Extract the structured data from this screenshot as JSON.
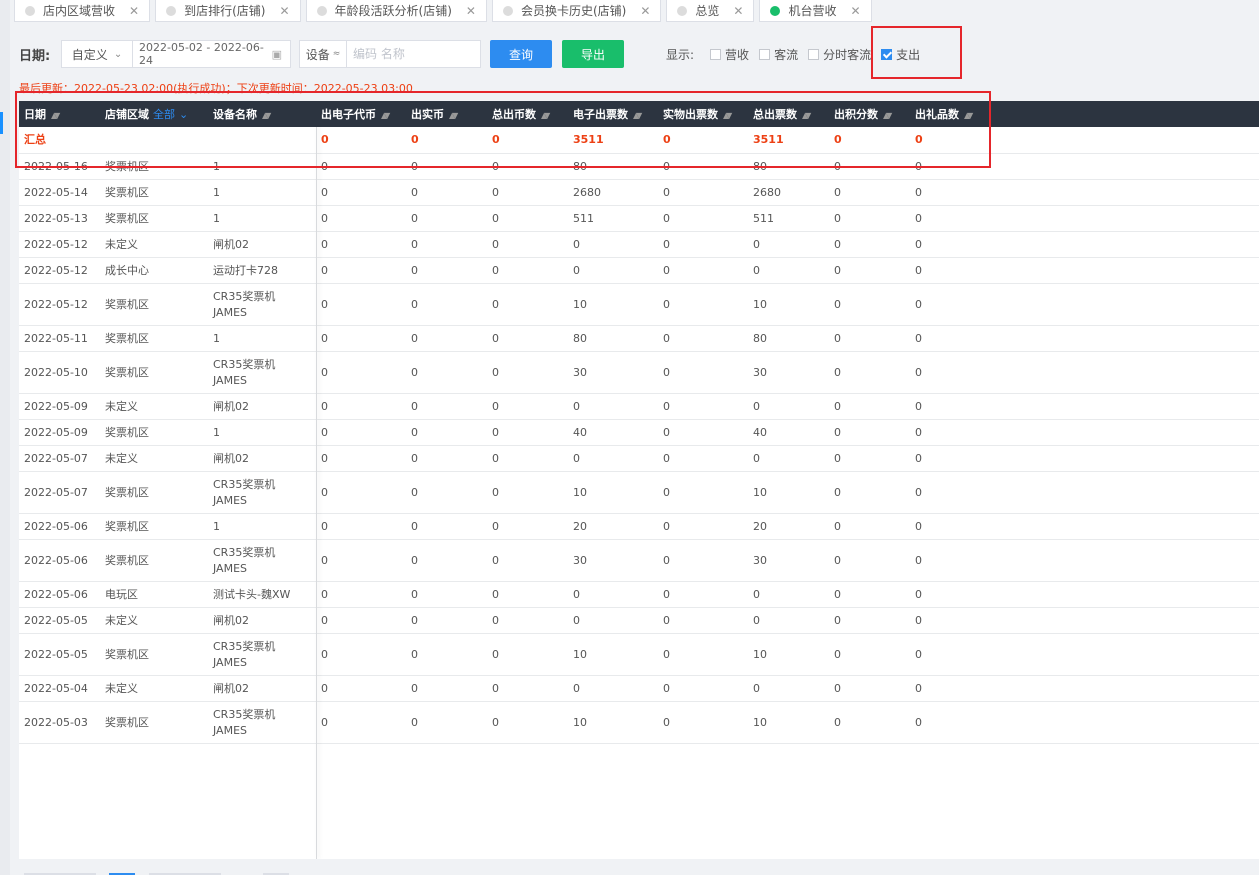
{
  "tabs": [
    {
      "label": "店内区域营收",
      "active": false
    },
    {
      "label": "到店排行(店铺)",
      "active": false
    },
    {
      "label": "年龄段活跃分析(店铺)",
      "active": false
    },
    {
      "label": "会员换卡历史(店铺)",
      "active": false
    },
    {
      "label": "总览",
      "active": false
    },
    {
      "label": "机台营收",
      "active": true
    }
  ],
  "toolbar": {
    "date_label": "日期:",
    "date_mode": "自定义",
    "date_range": "2022-05-02 - 2022-06-24",
    "device_label": "设备",
    "device_placeholder": "编码 名称",
    "query_label": "查询",
    "export_label": "导出",
    "show_label": "显示:",
    "checks": [
      {
        "label": "营收",
        "checked": false
      },
      {
        "label": "客流",
        "checked": false
      },
      {
        "label": "分时客流",
        "checked": false
      },
      {
        "label": "支出",
        "checked": true
      }
    ]
  },
  "last_update": "最后更新：2022-05-23 02:00(执行成功)；下次更新时间：2022-05-23 03:00",
  "table": {
    "columns": [
      "日期",
      "店铺区域",
      "设备名称",
      "出电子代币",
      "出实币",
      "总出币数",
      "电子出票数",
      "实物出票数",
      "总出票数",
      "出积分数",
      "出礼品数"
    ],
    "area_filter": "全部",
    "summary": [
      "汇总",
      "",
      "",
      "0",
      "0",
      "0",
      "3511",
      "0",
      "3511",
      "0",
      "0"
    ],
    "rows": [
      [
        "2022-05-16",
        "奖票机区",
        "1",
        "0",
        "0",
        "0",
        "80",
        "0",
        "80",
        "0",
        "0"
      ],
      [
        "2022-05-14",
        "奖票机区",
        "1",
        "0",
        "0",
        "0",
        "2680",
        "0",
        "2680",
        "0",
        "0"
      ],
      [
        "2022-05-13",
        "奖票机区",
        "1",
        "0",
        "0",
        "0",
        "511",
        "0",
        "511",
        "0",
        "0"
      ],
      [
        "2022-05-12",
        "未定义",
        "闸机02",
        "0",
        "0",
        "0",
        "0",
        "0",
        "0",
        "0",
        "0"
      ],
      [
        "2022-05-12",
        "成长中心",
        "运动打卡728",
        "0",
        "0",
        "0",
        "0",
        "0",
        "0",
        "0",
        "0"
      ],
      [
        "2022-05-12",
        "奖票机区",
        "CR35奖票机 JAMES",
        "0",
        "0",
        "0",
        "10",
        "0",
        "10",
        "0",
        "0"
      ],
      [
        "2022-05-11",
        "奖票机区",
        "1",
        "0",
        "0",
        "0",
        "80",
        "0",
        "80",
        "0",
        "0"
      ],
      [
        "2022-05-10",
        "奖票机区",
        "CR35奖票机 JAMES",
        "0",
        "0",
        "0",
        "30",
        "0",
        "30",
        "0",
        "0"
      ],
      [
        "2022-05-09",
        "未定义",
        "闸机02",
        "0",
        "0",
        "0",
        "0",
        "0",
        "0",
        "0",
        "0"
      ],
      [
        "2022-05-09",
        "奖票机区",
        "1",
        "0",
        "0",
        "0",
        "40",
        "0",
        "40",
        "0",
        "0"
      ],
      [
        "2022-05-07",
        "未定义",
        "闸机02",
        "0",
        "0",
        "0",
        "0",
        "0",
        "0",
        "0",
        "0"
      ],
      [
        "2022-05-07",
        "奖票机区",
        "CR35奖票机 JAMES",
        "0",
        "0",
        "0",
        "10",
        "0",
        "10",
        "0",
        "0"
      ],
      [
        "2022-05-06",
        "奖票机区",
        "1",
        "0",
        "0",
        "0",
        "20",
        "0",
        "20",
        "0",
        "0"
      ],
      [
        "2022-05-06",
        "奖票机区",
        "CR35奖票机 JAMES",
        "0",
        "0",
        "0",
        "30",
        "0",
        "30",
        "0",
        "0"
      ],
      [
        "2022-05-06",
        "电玩区",
        "测试卡头-魏XW",
        "0",
        "0",
        "0",
        "0",
        "0",
        "0",
        "0",
        "0"
      ],
      [
        "2022-05-05",
        "未定义",
        "闸机02",
        "0",
        "0",
        "0",
        "0",
        "0",
        "0",
        "0",
        "0"
      ],
      [
        "2022-05-05",
        "奖票机区",
        "CR35奖票机 JAMES",
        "0",
        "0",
        "0",
        "10",
        "0",
        "10",
        "0",
        "0"
      ],
      [
        "2022-05-04",
        "未定义",
        "闸机02",
        "0",
        "0",
        "0",
        "0",
        "0",
        "0",
        "0",
        "0"
      ],
      [
        "2022-05-03",
        "奖票机区",
        "CR35奖票机 JAMES",
        "0",
        "0",
        "0",
        "10",
        "0",
        "10",
        "0",
        "0"
      ]
    ]
  },
  "colors": {
    "header_bg": "#2c3440",
    "query": "#2d8cf0",
    "export": "#19be6b",
    "highlight": "#e5262b",
    "summary_text": "#ed4014"
  }
}
